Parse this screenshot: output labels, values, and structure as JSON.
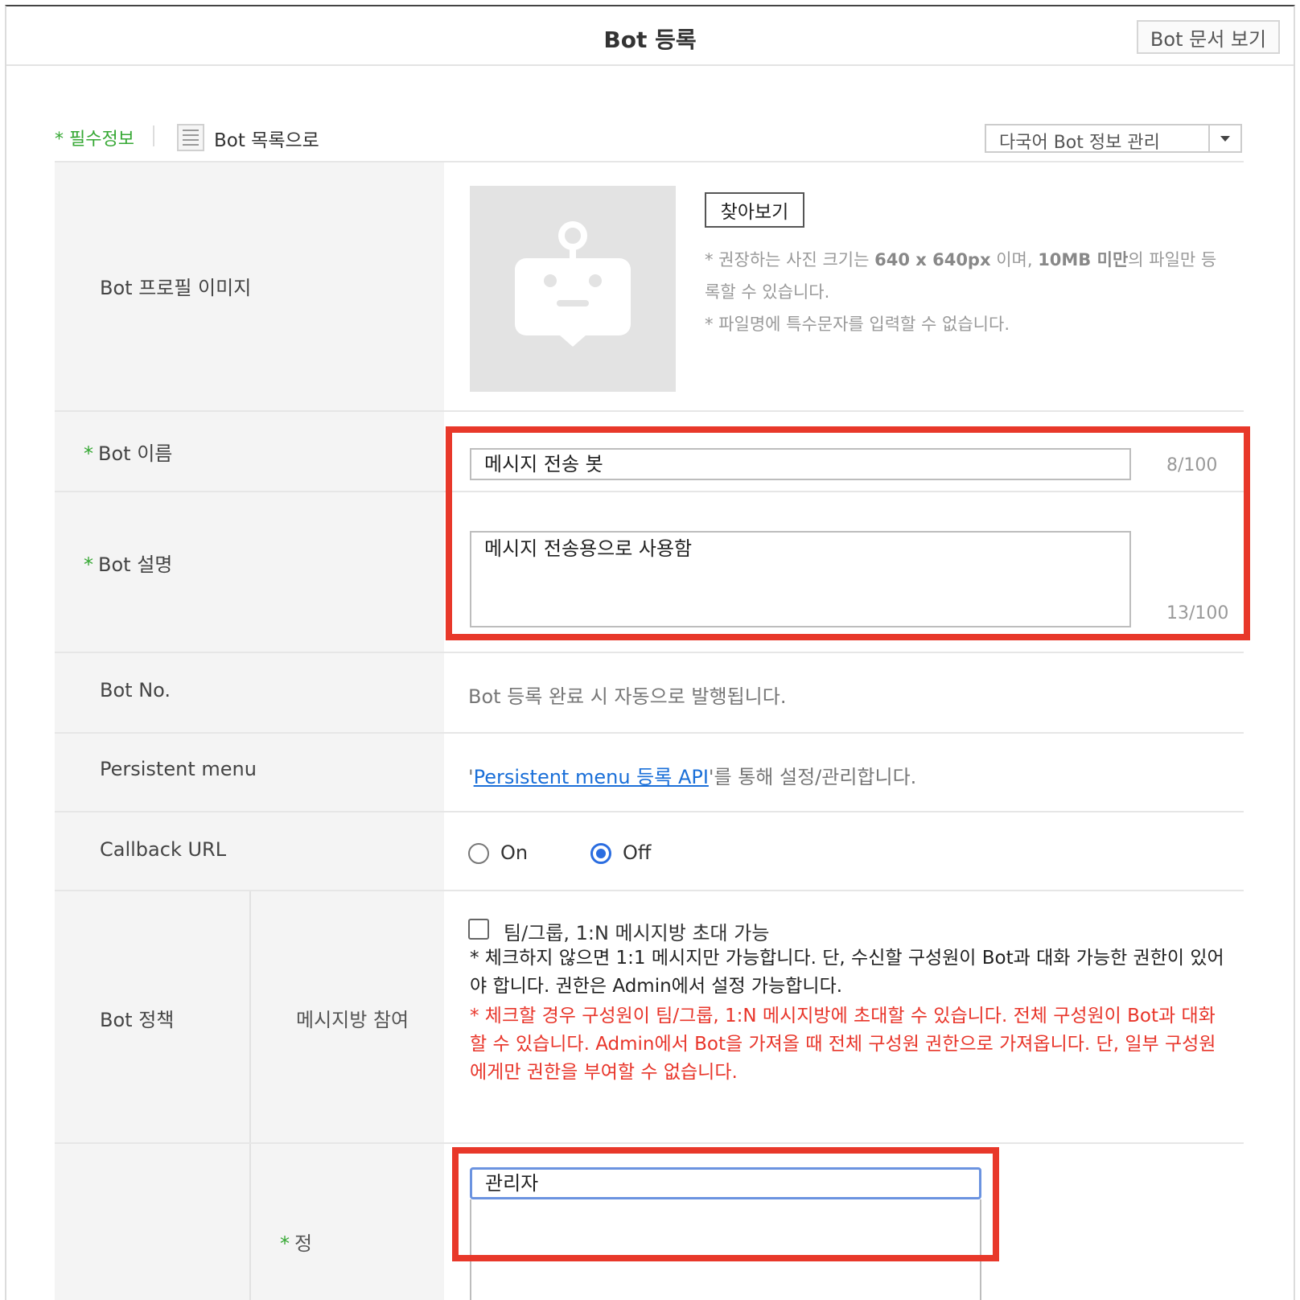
{
  "header": {
    "title": "Bot 등록",
    "doc_button": "Bot 문서 보기"
  },
  "subbar": {
    "required_info": "* 필수정보",
    "back_to_list": "Bot 목록으로",
    "lang_select": "다국어 Bot 정보 관리"
  },
  "form": {
    "profile": {
      "label": "Bot 프로필 이미지",
      "browse_button": "찾아보기",
      "help_line1_a": "* 권장하는 사진 크기는 ",
      "help_line1_size": "640 x 640px",
      "help_line1_b": " 이며, ",
      "help_line1_limit": "10MB 미만",
      "help_line1_c": "의 파일만 등록할 수 있습니다.",
      "help_line2": "* 파일명에 특수문자를 입력할 수 없습니다."
    },
    "name": {
      "star": "*",
      "label": "Bot 이름",
      "value": "메시지 전송 봇",
      "counter": "8/100"
    },
    "description": {
      "star": "*",
      "label": "Bot 설명",
      "value": "메시지 전송용으로 사용함",
      "counter": "13/100"
    },
    "bot_no": {
      "label": "Bot No.",
      "text": "Bot 등록 완료 시 자동으로 발행됩니다."
    },
    "persistent_menu": {
      "label": "Persistent menu",
      "quote_open": "'",
      "link": "Persistent menu 등록 API",
      "text_after": "'를 통해 설정/관리합니다."
    },
    "callback": {
      "label": "Callback URL",
      "on_label": "On",
      "off_label": "Off",
      "selected": "Off"
    },
    "policy": {
      "label": "Bot 정책",
      "sub_label": "메시지방 참여",
      "checkbox_label": "팀/그룹, 1:N 메시지방 초대 가능",
      "checked": false,
      "note_black": "* 체크하지 않으면 1:1 메시지만 가능합니다. 단, 수신할 구성원이 Bot과 대화 가능한 권한이 있어야 합니다. 권한은 Admin에서 설정 가능합니다.",
      "note_red": "* 체크할 경우 구성원이 팀/그룹, 1:N 메시지방에 초대할 수 있습니다. 전체 구성원이 Bot과 대화할 수 있습니다. Admin에서 Bot을 가져올 때 전체 구성원 권한으로 가져옵니다. 단, 일부 구성원에게만 권한을 부여할 수 없습니다."
    },
    "manager": {
      "star": "*",
      "label": "정",
      "value": "관리자"
    }
  },
  "colors": {
    "accent_green": "#36a834",
    "highlight_red": "#e8382a",
    "link_blue": "#1a6fd8",
    "radio_blue": "#2b6de0"
  }
}
